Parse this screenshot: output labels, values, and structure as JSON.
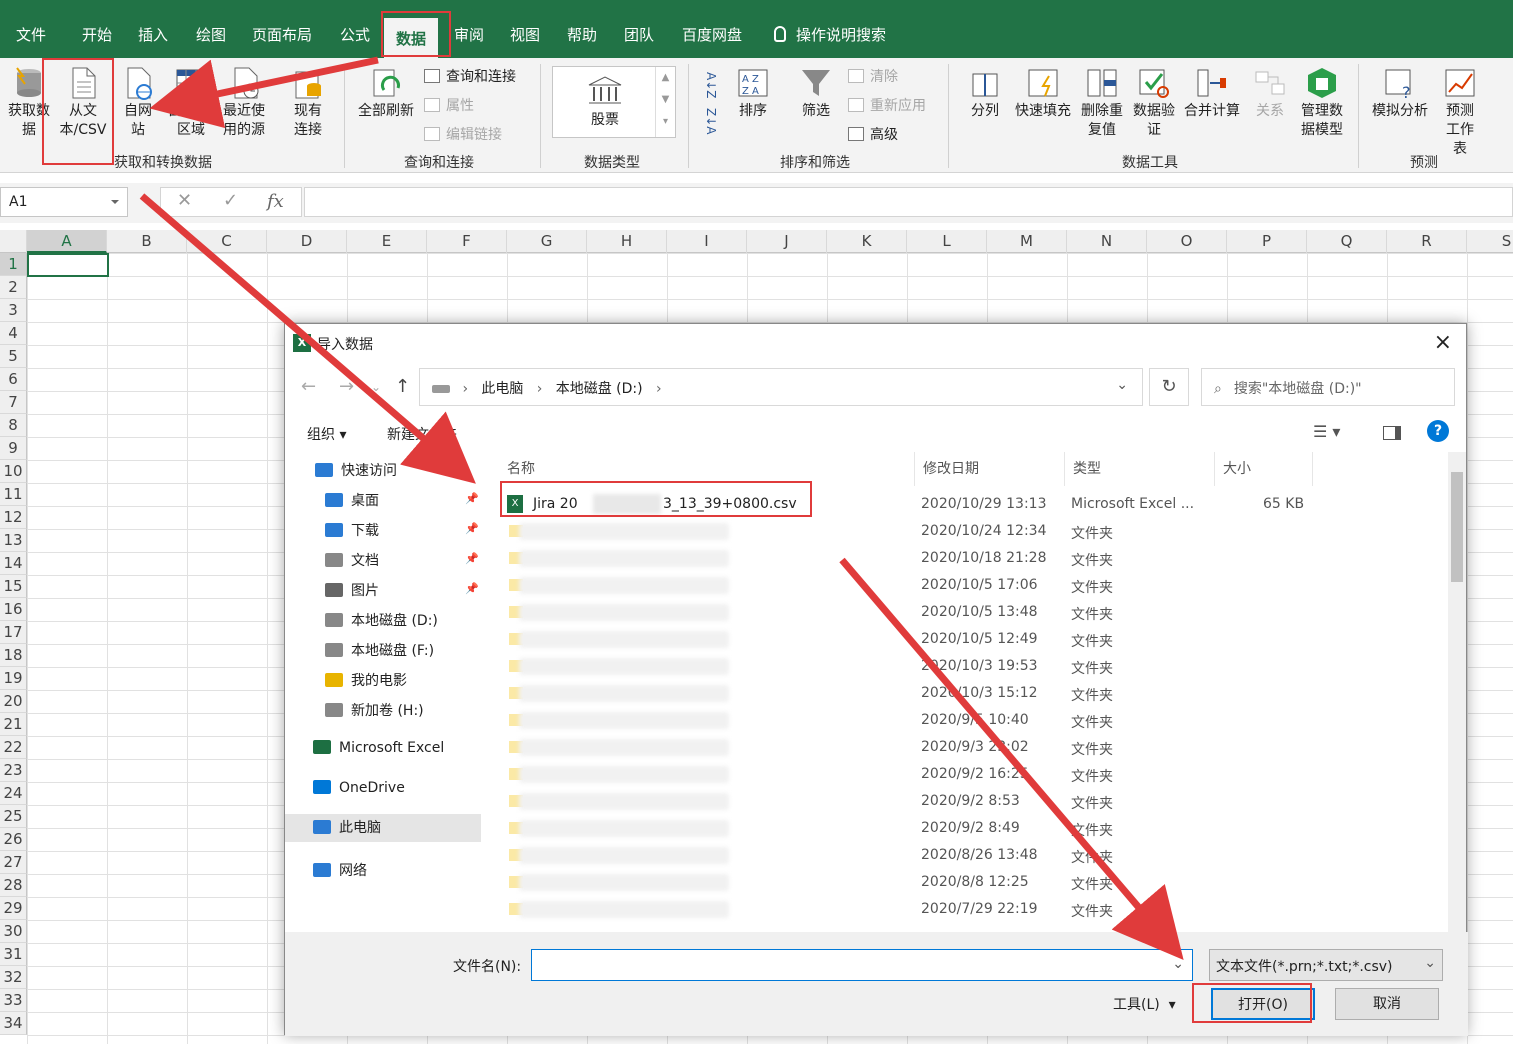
{
  "ribbon_tabs": [
    "文件",
    "开始",
    "插入",
    "绘图",
    "页面布局",
    "公式",
    "数据",
    "审阅",
    "视图",
    "帮助",
    "团队",
    "百度网盘"
  ],
  "active_tab": "数据",
  "tell_me": "操作说明搜索",
  "ribbon": {
    "get_data": "获取数据",
    "from_text_csv": "从文本/CSV",
    "from_web": "自网站",
    "from_table": "自表格/区域",
    "recent_sources": "最近使用的源",
    "existing_connections": "现有连接",
    "refresh_all": "全部刷新",
    "queries_connections": "查询和连接",
    "properties": "属性",
    "edit_links": "编辑链接",
    "stocks": "股票",
    "sort_az": "A↓Z",
    "sort_za": "Z↓A",
    "sort": "排序",
    "filter": "筛选",
    "clear": "清除",
    "reapply": "重新应用",
    "advanced": "高级",
    "text_to_columns": "分列",
    "flash_fill": "快速填充",
    "remove_duplicates": "删除重复值",
    "data_validation": "数据验证",
    "consolidate": "合并计算",
    "relationships": "关系",
    "manage_data_model": "管理数据模型",
    "what_if": "模拟分析",
    "forecast_sheet": "预测工作表",
    "groups": {
      "get_transform": "获取和转换数据",
      "queries": "查询和连接",
      "data_types": "数据类型",
      "sort_filter": "排序和筛选",
      "data_tools": "数据工具",
      "forecast": "预测"
    }
  },
  "name_box": "A1",
  "fx_label": "fx",
  "columns": [
    "A",
    "B",
    "C",
    "D",
    "E",
    "F",
    "G",
    "H",
    "I",
    "J",
    "K",
    "L",
    "M",
    "N",
    "O",
    "P",
    "Q",
    "R",
    "S"
  ],
  "rows": [
    "1",
    "2",
    "3",
    "4",
    "5",
    "6",
    "7",
    "8",
    "9",
    "10",
    "11",
    "12",
    "13",
    "14",
    "15",
    "16",
    "17",
    "18",
    "19",
    "20",
    "21",
    "22",
    "23",
    "24",
    "25",
    "26",
    "27",
    "28",
    "29",
    "30",
    "31",
    "32",
    "33",
    "34"
  ],
  "dialog": {
    "title": "导入数据",
    "breadcrumb": [
      "此电脑",
      "本地磁盘 (D:)"
    ],
    "search_placeholder": "搜索\"本地磁盘 (D:)\"",
    "organize": "组织 ▾",
    "new_folder": "新建文件夹",
    "nav": [
      {
        "label": "快速访问",
        "icon": "star-icon"
      },
      {
        "label": "桌面",
        "icon": "desktop-icon"
      },
      {
        "label": "下载",
        "icon": "download-icon"
      },
      {
        "label": "文档",
        "icon": "document-icon"
      },
      {
        "label": "图片",
        "icon": "picture-icon"
      },
      {
        "label": "本地磁盘 (D:)",
        "icon": "drive-icon"
      },
      {
        "label": "本地磁盘 (F:)",
        "icon": "drive-icon"
      },
      {
        "label": "我的电影",
        "icon": "folder-icon"
      },
      {
        "label": "新加卷 (H:)",
        "icon": "drive-icon"
      },
      {
        "label": "Microsoft Excel",
        "icon": "excel-icon"
      },
      {
        "label": "OneDrive",
        "icon": "cloud-icon"
      },
      {
        "label": "此电脑",
        "icon": "computer-icon"
      },
      {
        "label": "网络",
        "icon": "network-icon"
      }
    ],
    "headers": {
      "name": "名称",
      "date": "修改日期",
      "type": "类型",
      "size": "大小"
    },
    "files": [
      {
        "name": "Jira 20",
        "name_end": "3_13_39+0800.csv",
        "date": "2020/10/29 13:13",
        "type": "Microsoft Excel ...",
        "size": "65 KB"
      },
      {
        "date": "2020/10/24 12:34",
        "type": "文件夹"
      },
      {
        "date": "2020/10/18 21:28",
        "type": "文件夹"
      },
      {
        "date": "2020/10/5 17:06",
        "type": "文件夹"
      },
      {
        "date": "2020/10/5 13:48",
        "type": "文件夹"
      },
      {
        "date": "2020/10/5 12:49",
        "type": "文件夹"
      },
      {
        "date": "2020/10/3 19:53",
        "type": "文件夹"
      },
      {
        "date": "2020/10/3 15:12",
        "type": "文件夹"
      },
      {
        "date": "2020/9/5 10:40",
        "type": "文件夹"
      },
      {
        "date": "2020/9/3 23:02",
        "type": "文件夹"
      },
      {
        "date": "2020/9/2 16:25",
        "type": "文件夹"
      },
      {
        "date": "2020/9/2 8:53",
        "type": "文件夹"
      },
      {
        "date": "2020/9/2 8:49",
        "type": "文件夹"
      },
      {
        "date": "2020/8/26 13:48",
        "type": "文件夹"
      },
      {
        "date": "2020/8/8 12:25",
        "type": "文件夹"
      },
      {
        "date": "2020/7/29 22:19",
        "type": "文件夹"
      }
    ],
    "filename_label": "文件名(N):",
    "filename_value": "",
    "filter_value": "文本文件(*.prn;*.txt;*.csv)",
    "tools": "工具(L)",
    "open": "打开(O)",
    "cancel": "取消"
  },
  "colors": {
    "excel_green": "#217346",
    "highlight_red": "#e03b3b",
    "accent_blue": "#0078d7"
  }
}
